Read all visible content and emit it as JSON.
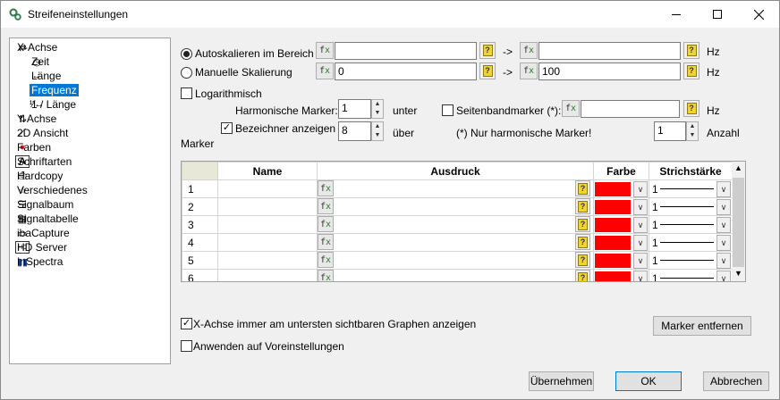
{
  "window": {
    "title": "Streifeneinstellungen"
  },
  "tree": [
    {
      "label": "X-Achse",
      "icon": "x-axis-icon"
    },
    {
      "label": "Zeit",
      "icon": "clock-icon"
    },
    {
      "label": "Länge",
      "icon": "length-icon"
    },
    {
      "label": "Frequenz",
      "icon": "frequency-icon",
      "selected": true
    },
    {
      "label": "1 / Länge",
      "icon": "inverse-length-icon"
    },
    {
      "label": "Y-Achse",
      "icon": "y-axis-icon"
    },
    {
      "label": "2D Ansicht",
      "icon": "2d-view-icon"
    },
    {
      "label": "Farben",
      "icon": "colors-icon"
    },
    {
      "label": "Schriftarten",
      "icon": "font-icon"
    },
    {
      "label": "Hardcopy",
      "icon": "printer-icon"
    },
    {
      "label": "Verschiedenes",
      "icon": "star-icon"
    },
    {
      "label": "Signalbaum",
      "icon": "signal-tree-icon"
    },
    {
      "label": "Signaltabelle",
      "icon": "table-icon"
    },
    {
      "label": "ibaCapture",
      "icon": "camera-icon"
    },
    {
      "label": "HD Server",
      "icon": "hd-server-icon"
    },
    {
      "label": "InSpectra",
      "icon": "spectrum-icon"
    }
  ],
  "scaling": {
    "auto_label": "Autoskalieren im Bereich",
    "manual_label": "Manuelle Skalierung",
    "auto_from": "",
    "auto_to": "",
    "manual_from": "0",
    "manual_to": "100",
    "arrow": "->",
    "unit": "Hz",
    "log_label": "Logarithmisch"
  },
  "marker": {
    "harmonic_label": "Harmonische Marker:",
    "harmonic_value": "1",
    "under_label": "unter",
    "sideband_label": "Seitenbandmarker (*):",
    "sideband_value": "",
    "sideband_unit": "Hz",
    "labels_checkbox": "Bezeichner anzeigen",
    "over_value": "8",
    "over_label": "über",
    "note": "(*) Nur harmonische Marker!",
    "count_value": "1",
    "count_label": "Anzahl",
    "section_label": "Marker"
  },
  "table": {
    "headers": [
      "Name",
      "Ausdruck",
      "Farbe",
      "Strichstärke"
    ],
    "rows": [
      {
        "num": "1",
        "name": "",
        "expr": "",
        "color": "#ff0000",
        "width": "1"
      },
      {
        "num": "2",
        "name": "",
        "expr": "",
        "color": "#ff0000",
        "width": "1"
      },
      {
        "num": "3",
        "name": "",
        "expr": "",
        "color": "#ff0000",
        "width": "1"
      },
      {
        "num": "4",
        "name": "",
        "expr": "",
        "color": "#ff0000",
        "width": "1"
      },
      {
        "num": "5",
        "name": "",
        "expr": "",
        "color": "#ff0000",
        "width": "1"
      },
      {
        "num": "6",
        "name": "",
        "expr": "",
        "color": "#ff0000",
        "width": "1"
      }
    ]
  },
  "options": {
    "bottom_axis_label": "X-Achse immer am untersten sichtbaren Graphen anzeigen",
    "apply_defaults_label": "Anwenden auf Voreinstellungen",
    "remove_markers": "Marker entfernen"
  },
  "buttons": {
    "apply": "Übernehmen",
    "ok": "OK",
    "cancel": "Abbrechen"
  }
}
